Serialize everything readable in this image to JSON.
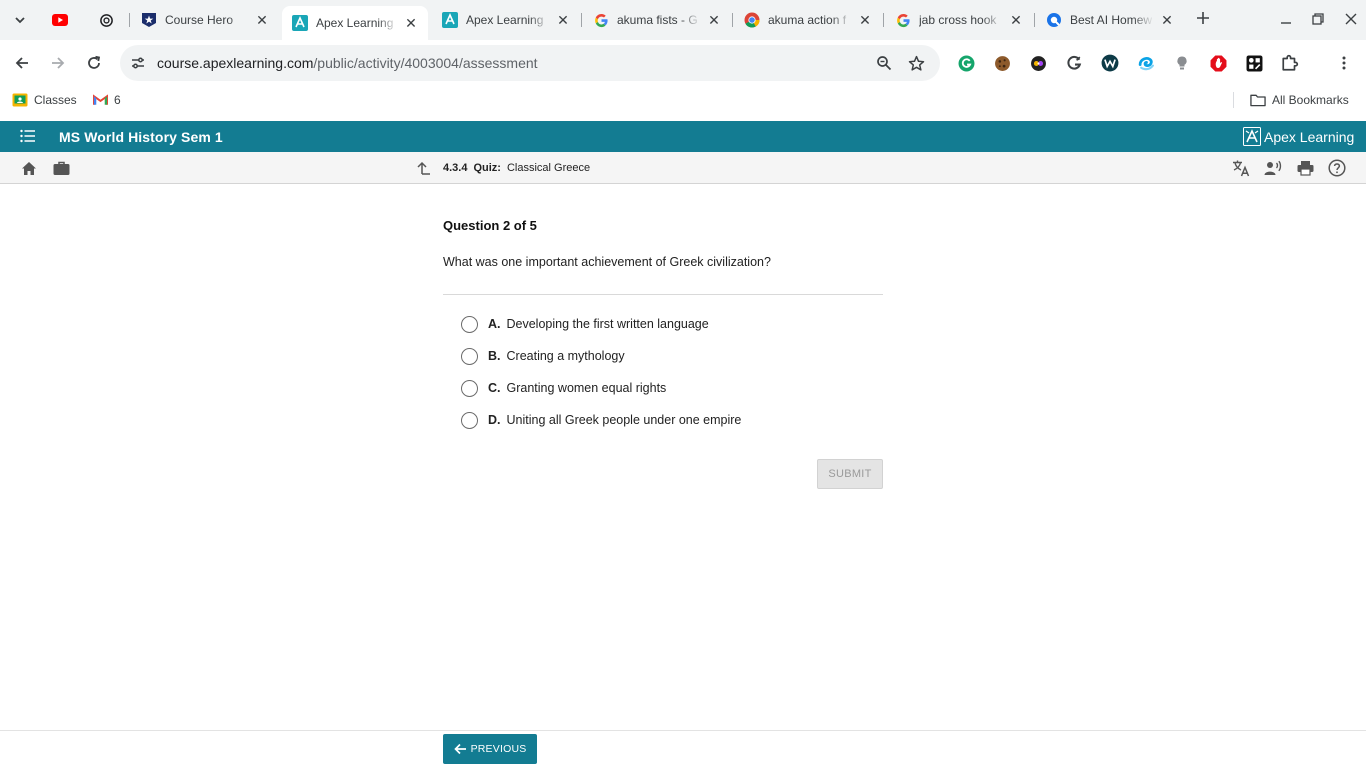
{
  "browser": {
    "tabs": [
      {
        "title": ""
      },
      {
        "title": ""
      },
      {
        "title": "Course Hero"
      },
      {
        "title": "Apex Learning"
      },
      {
        "title": "Apex Learning"
      },
      {
        "title": "akuma fists - G"
      },
      {
        "title": "akuma action f"
      },
      {
        "title": "jab cross hook"
      },
      {
        "title": "Best AI Homew"
      }
    ],
    "address": {
      "host": "course.apexlearning.com",
      "path": "/public/activity/4003004/assessment"
    },
    "bookmarks": {
      "classes": "Classes",
      "gmail_count": "6",
      "all_bookmarks": "All Bookmarks"
    }
  },
  "app": {
    "course_title": "MS World History Sem 1",
    "brand": "Apex Learning",
    "accent_color": "#137c92"
  },
  "activity": {
    "number": "4.3.4",
    "type": "Quiz:",
    "title": "Classical Greece"
  },
  "question": {
    "counter": "Question 2 of 5",
    "text": "What was one important achievement of Greek civilization?",
    "choices": [
      {
        "letter": "A.",
        "text": "Developing the first written language"
      },
      {
        "letter": "B.",
        "text": "Creating a mythology"
      },
      {
        "letter": "C.",
        "text": "Granting women equal rights"
      },
      {
        "letter": "D.",
        "text": "Uniting all Greek people under one empire"
      }
    ],
    "submit_label": "SUBMIT"
  },
  "footer": {
    "previous_label": "PREVIOUS"
  }
}
